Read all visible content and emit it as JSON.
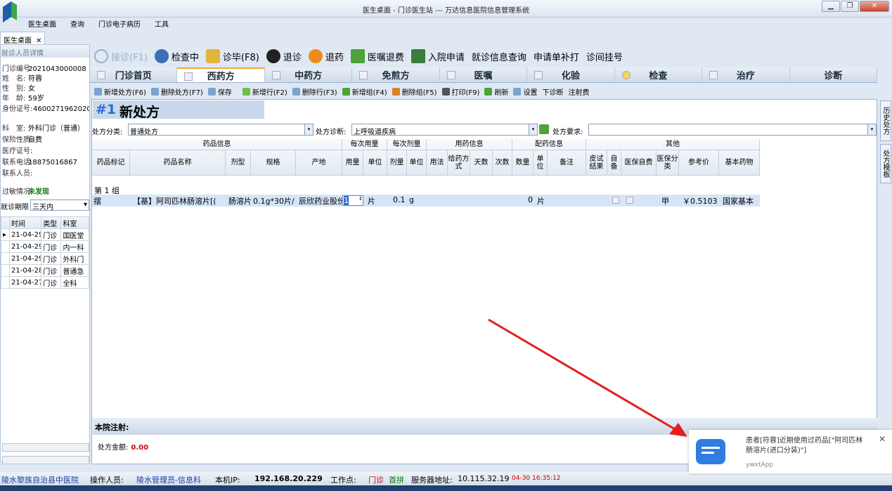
{
  "window": {
    "title": "医生桌面 - 门诊医生站 --- 万达信息医院信息管理系统",
    "min": "▁",
    "max": "❐",
    "close": "✕"
  },
  "menu": [
    "医生桌面",
    "查询",
    "门诊电子病历",
    "工具"
  ],
  "doc_tab": {
    "label": "医生桌面",
    "close": "✕"
  },
  "patient": {
    "header": "就诊人员详情",
    "fields": [
      {
        "k": "门诊编号:",
        "v": "2021043000008"
      },
      {
        "k": "姓　名:",
        "v": "符蓉"
      },
      {
        "k": "性　别:",
        "v": "女"
      },
      {
        "k": "年　龄:",
        "v": "59岁"
      },
      {
        "k": "身份证号:",
        "v": "4600271962020"
      },
      {
        "k": "科　室:",
        "v": "外科门诊（普通）"
      },
      {
        "k": "保险性质:",
        "v": "自费"
      },
      {
        "k": "医疗证号:",
        "v": ""
      },
      {
        "k": "联系电话:",
        "v": "18875016867"
      },
      {
        "k": "联系人员:",
        "v": ""
      }
    ],
    "allergy_label": "过敏情况:",
    "allergy_value": "未发现",
    "period_label": "就诊期限",
    "period_value": "三天内"
  },
  "history": {
    "cols": [
      "时间",
      "类型",
      "科室"
    ],
    "rows": [
      [
        "21-04-29",
        "门诊",
        "国医堂"
      ],
      [
        "21-04-29",
        "门诊",
        "内一科"
      ],
      [
        "21-04-29",
        "门诊",
        "外科门"
      ],
      [
        "21-04-28",
        "门诊",
        "普通急"
      ],
      [
        "21-04-27",
        "门诊",
        "全科"
      ]
    ]
  },
  "toolbar1": [
    {
      "label": "接诊(F1)",
      "color": "#9bb0c6",
      "icon": "stethoscope-icon"
    },
    {
      "label": "检查中",
      "color": "#3a6fb7",
      "icon": "doctor-icon"
    },
    {
      "label": "诊毕(F8)",
      "color": "#e2b53a",
      "icon": "pen-icon"
    },
    {
      "label": "退诊",
      "color": "#222",
      "icon": "user-remove-icon"
    },
    {
      "label": "退药",
      "color": "#f08a1d",
      "icon": "return-icon"
    },
    {
      "label": "医嘱退费",
      "color": "#4da23a",
      "icon": "yen-icon"
    },
    {
      "label": "入院申请",
      "color": "#3b7d3b",
      "icon": "admission-icon"
    },
    {
      "label": "就诊信息查询",
      "color": "",
      "icon": ""
    },
    {
      "label": "申请单补打",
      "color": "",
      "icon": ""
    },
    {
      "label": "诊间挂号",
      "color": "",
      "icon": ""
    }
  ],
  "tabs": [
    "门诊首页",
    "西药方",
    "中药方",
    "免煎方",
    "医嘱",
    "化验",
    "检查",
    "治疗",
    "诊断"
  ],
  "active_tab": 1,
  "toolbar2": [
    "新增处方(F6)",
    "删除处方(F7)",
    "保存",
    "新增行(F2)",
    "删除行(F3)",
    "新增组(F4)",
    "删除组(F5)",
    "打印(F9)",
    "刷新",
    "设置",
    "下诊断",
    "注射费"
  ],
  "rx": {
    "num": "#1",
    "title": "新处方",
    "type_label": "处方分类:",
    "type_value": "普通处方",
    "diag_label": "处方诊断:",
    "diag_value": "上呼吸道疾病",
    "req_label": "处方要求:",
    "req_value": ""
  },
  "grid": {
    "groups": [
      "药品信息",
      "每次用量",
      "每次剂量",
      "用药信息",
      "配药信息",
      "其他"
    ],
    "cols": [
      "药品标记",
      "药品名称",
      "剂型",
      "规格",
      "产地",
      "用量",
      "单位",
      "剂量",
      "单位",
      "用法",
      "给药方式",
      "天数",
      "次数",
      "数量",
      "单位",
      "备注",
      "皮试结果",
      "自备",
      "医保自费",
      "医保分类",
      "参考价",
      "基本药物"
    ],
    "group_label": "第 1 组",
    "row": {
      "mark": "摆",
      "name": "【基】阿司匹林肠溶片[(",
      "form": "肠溶片",
      "spec": "0.1g*30片/",
      "origin": "辰欣药业股份",
      "qty": "1",
      "unit": "片",
      "dose": "0.1",
      "dunit": "g",
      "num": "0",
      "nunit": "片",
      "cls": "甲",
      "price": "￥0.5103",
      "basic": "国家基本"
    }
  },
  "note_label": "本院注射:",
  "amount_label": "处方金额:",
  "amount_value": "0.00",
  "right_tabs": [
    "历史处方",
    "处方模板"
  ],
  "status": {
    "hospital": "陵水黎族自治县中医院",
    "op_label": "操作人员:",
    "op_value": "陵水管理员-信息科",
    "ip_label": "本机IP:",
    "ip_value": "192.168.20.229",
    "ws_label": "工作点:",
    "ws_value": "门诊",
    "first": "首拼",
    "srv_label": "服务器地址:",
    "srv_value": "10.115.32.19",
    "time": "04-30 16:35:12"
  },
  "notification": {
    "message": "患者[符蓉]近期使用过药品[\"阿司匹林肠溶片(进口分装)\"]",
    "app": "ywxtApp",
    "close": "✕"
  },
  "colors": {
    "accent": "#2a6fd6",
    "alert": "#d40000",
    "arrow": "#e02020"
  }
}
